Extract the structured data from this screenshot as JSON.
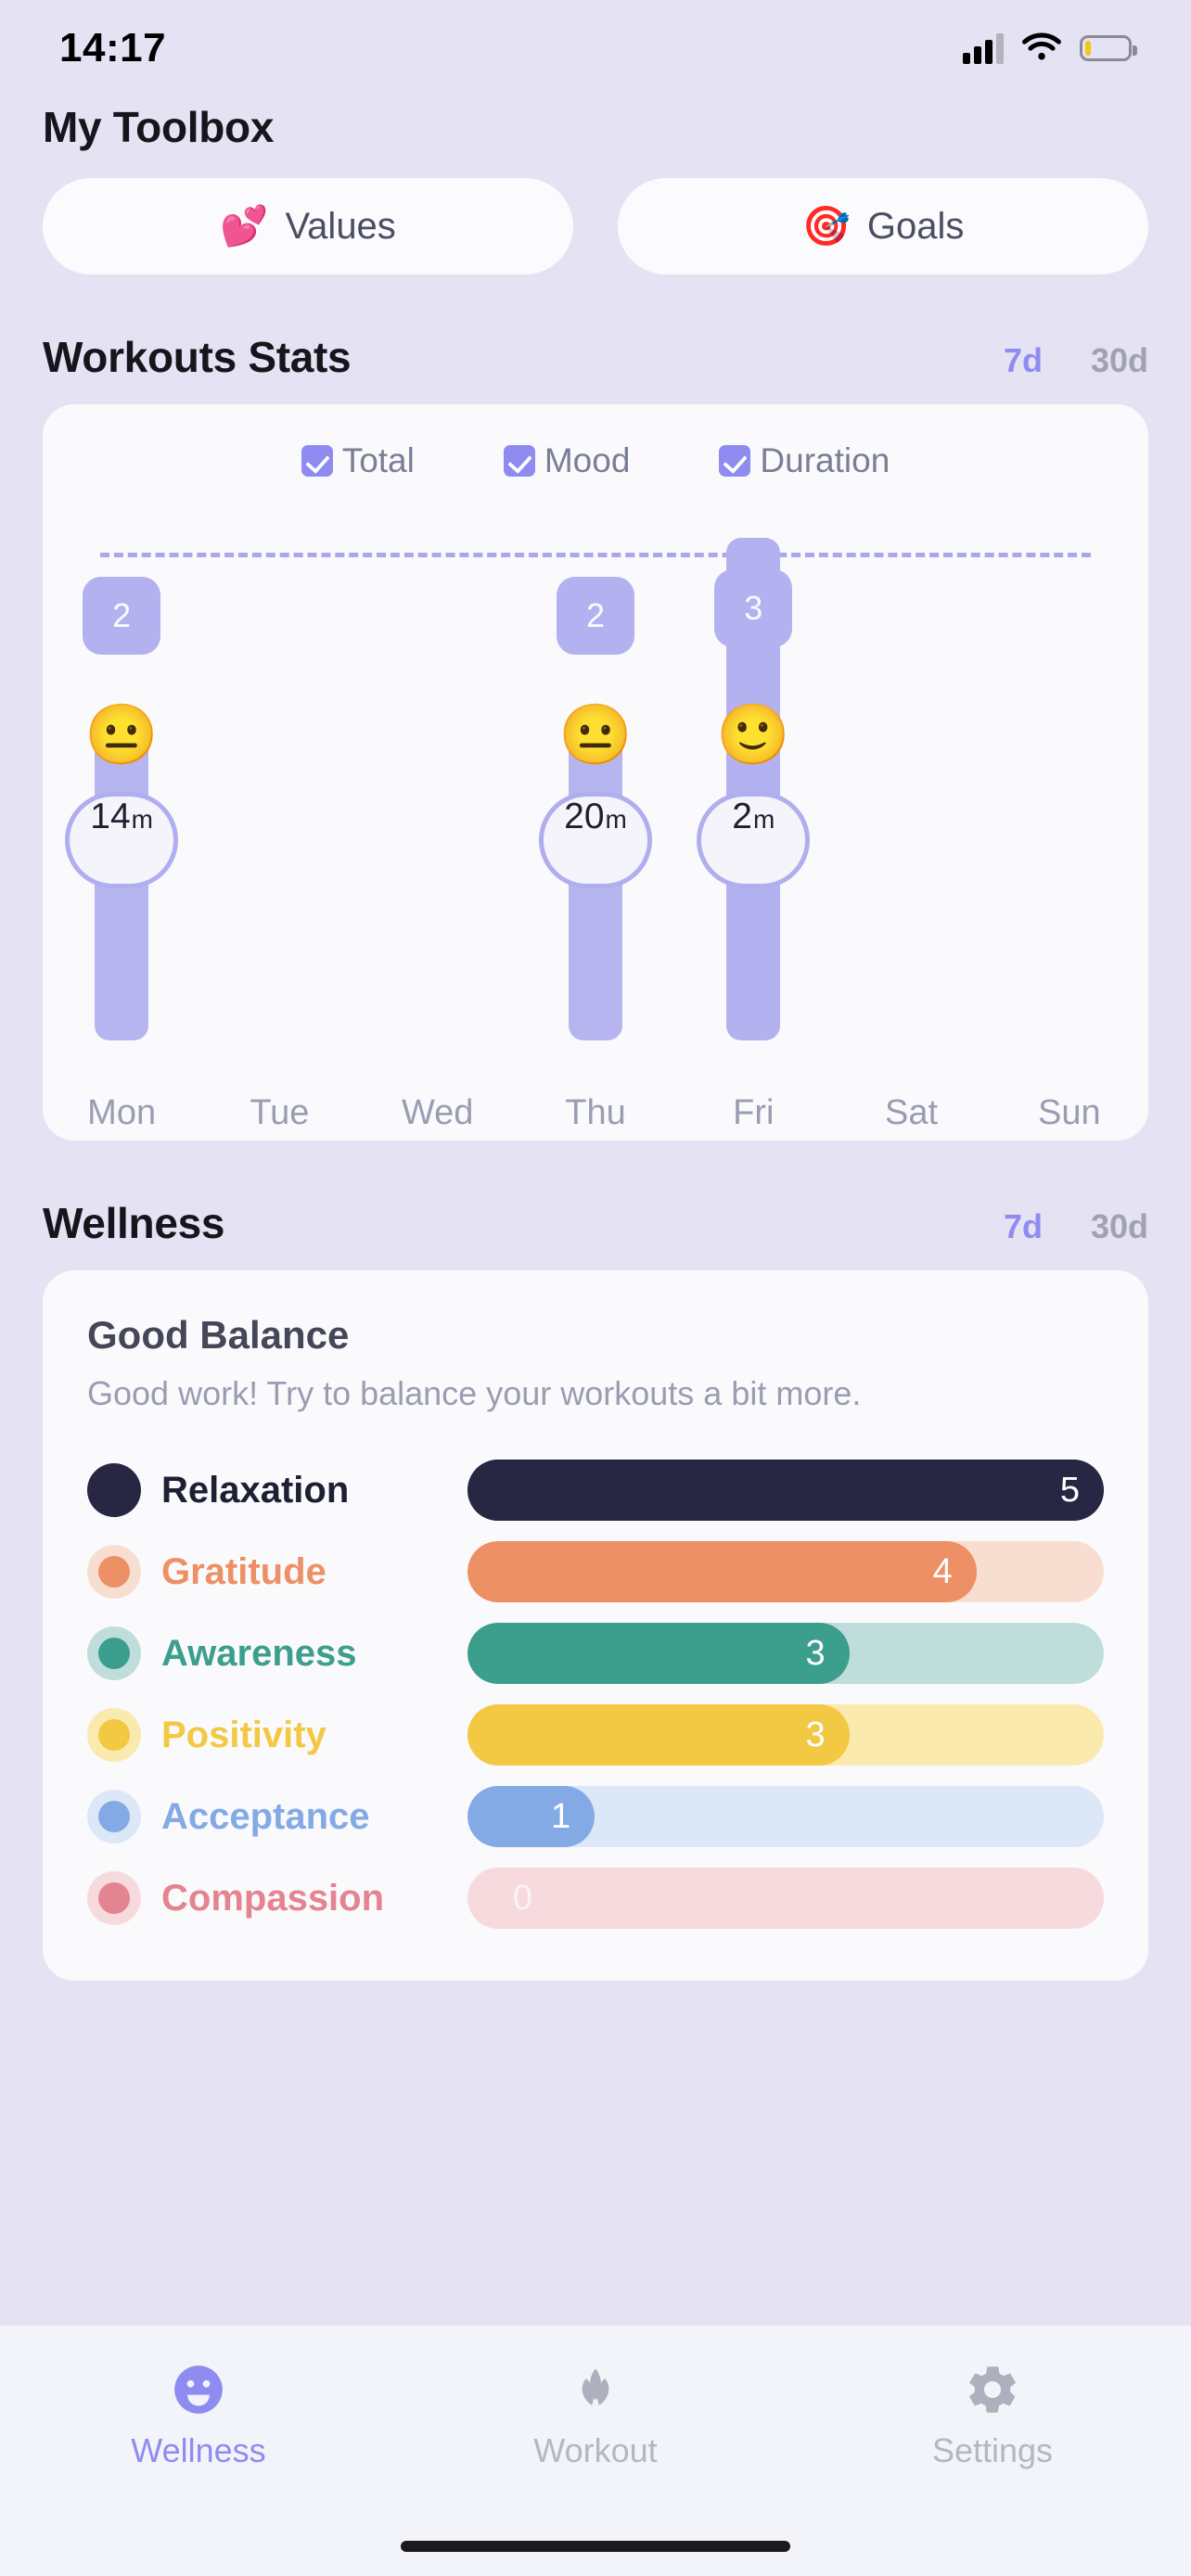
{
  "status_bar": {
    "time": "14:17",
    "signal_icon": "cellular-signal-icon",
    "wifi_icon": "wifi-icon",
    "battery_icon": "battery-icon"
  },
  "header": {
    "title": "My Toolbox"
  },
  "top_pills": [
    {
      "label": "Values",
      "icon": "heart-icon",
      "color": "#f4719b"
    },
    {
      "label": "Goals",
      "icon": "target-icon",
      "color": "#5ec79a"
    }
  ],
  "workouts": {
    "section_title": "Workouts Stats",
    "range": {
      "active": "7d",
      "inactive": "30d"
    },
    "legend": [
      {
        "label": "Total",
        "checked": true
      },
      {
        "label": "Mood",
        "checked": true
      },
      {
        "label": "Duration",
        "checked": true
      }
    ]
  },
  "chart_data": {
    "type": "bar",
    "title": "Workouts Stats",
    "xlabel": "",
    "ylabel": "",
    "grid": false,
    "legend_position": "top",
    "categories": [
      "Mon",
      "Tue",
      "Wed",
      "Thu",
      "Fri",
      "Sat",
      "Sun"
    ],
    "series": [
      {
        "name": "Total",
        "values": [
          2,
          0,
          0,
          2,
          3,
          0,
          0
        ]
      },
      {
        "name": "Duration",
        "unit": "m",
        "values": [
          14,
          0,
          0,
          20,
          2,
          0,
          0
        ]
      },
      {
        "name": "Mood",
        "values": [
          "neutral",
          "",
          "",
          "neutral",
          "happy",
          "",
          ""
        ]
      }
    ],
    "duration_labels": [
      "14m",
      "",
      "",
      "20m",
      "2m",
      "",
      ""
    ],
    "total_labels": [
      "2",
      "",
      "",
      "2",
      "3",
      "",
      ""
    ],
    "mood_emoji": [
      "😐",
      "",
      "",
      "😐",
      "🙂",
      "",
      ""
    ],
    "bar_color": "#b3b1ef",
    "threshold_line": true
  },
  "wellness": {
    "section_title": "Wellness",
    "range": {
      "active": "7d",
      "inactive": "30d"
    },
    "card_title": "Good Balance",
    "card_subtitle": "Good work! Try to balance your workouts a bit more.",
    "max_value": 5,
    "rows": [
      {
        "label": "Relaxation",
        "value": 5,
        "color": "#272643",
        "track": "#272643",
        "label_color": "#1d1f33"
      },
      {
        "label": "Gratitude",
        "value": 4,
        "color": "#ee9065",
        "track": "#f8ded1",
        "label_color": "#ee9065"
      },
      {
        "label": "Awareness",
        "value": 3,
        "color": "#3c9e8d",
        "track": "#bfdedb",
        "label_color": "#3c9e8d"
      },
      {
        "label": "Positivity",
        "value": 3,
        "color": "#f3c842",
        "track": "#faeaae",
        "label_color": "#f3c842"
      },
      {
        "label": "Acceptance",
        "value": 1,
        "color": "#84aae6",
        "track": "#dce7f7",
        "label_color": "#84aae6"
      },
      {
        "label": "Compassion",
        "value": 0,
        "color": "#e38490",
        "track": "#f6dade",
        "label_color": "#e38490"
      }
    ]
  },
  "tabbar": {
    "items": [
      {
        "label": "Wellness",
        "icon": "smiley-face-icon",
        "active": true
      },
      {
        "label": "Workout",
        "icon": "lotus-icon",
        "active": false
      },
      {
        "label": "Settings",
        "icon": "gear-icon",
        "active": false
      }
    ]
  }
}
